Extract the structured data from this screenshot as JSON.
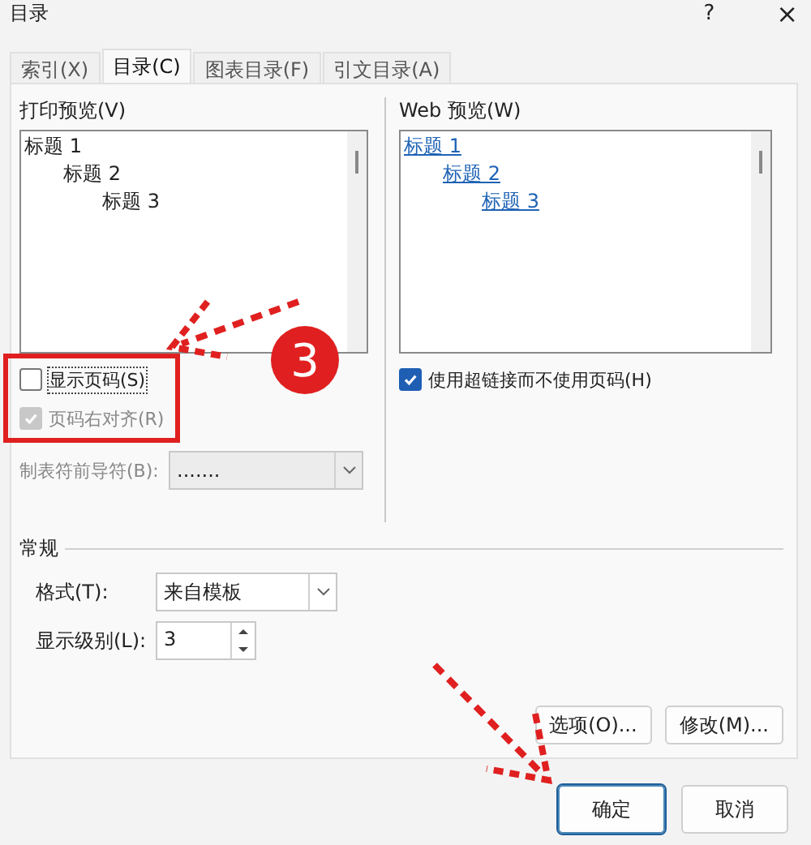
{
  "window": {
    "title": "目录",
    "help": "?",
    "close": "×"
  },
  "tabs": [
    {
      "label": "索引(X)",
      "selected": false
    },
    {
      "label": "目录(C)",
      "selected": true
    },
    {
      "label": "图表目录(F)",
      "selected": false
    },
    {
      "label": "引文目录(A)",
      "selected": false
    }
  ],
  "print_preview": {
    "label": "打印预览(V)",
    "entries": [
      {
        "text": "标题 1",
        "children": [
          {
            "text": "标题 2",
            "children": [
              {
                "text": "标题 3"
              }
            ]
          }
        ]
      }
    ]
  },
  "options": [
    {
      "label": "显示页码(S)",
      "checked": false,
      "disabled": false,
      "focused": true
    },
    {
      "label": "页码右对齐(R)",
      "checked": true,
      "disabled": true,
      "focused": false
    }
  ],
  "tab_leader": {
    "label": "制表符前导符(B):",
    "value": ".......",
    "disabled": true
  },
  "web_preview": {
    "label": "Web 预览(W)",
    "entries": [
      {
        "text": "标题 1",
        "children": [
          {
            "text": "标题 2",
            "children": [
              {
                "text": "标题 3"
              }
            ]
          }
        ]
      }
    ]
  },
  "hyperlinks": {
    "label": "使用超链接而不使用页码(H)",
    "checked": true
  },
  "general": {
    "title": "常规",
    "format": {
      "label": "格式(T):",
      "value": "来自模板"
    },
    "levels": {
      "label": "显示级别(L):",
      "value": "3"
    }
  },
  "buttons": [
    {
      "label": "选项(O)..."
    },
    {
      "label": "修改(M)..."
    }
  ],
  "footer_buttons": [
    {
      "label": "确定",
      "default": true
    },
    {
      "label": "取消",
      "default": false
    }
  ],
  "annotation": {
    "callout": "3"
  }
}
